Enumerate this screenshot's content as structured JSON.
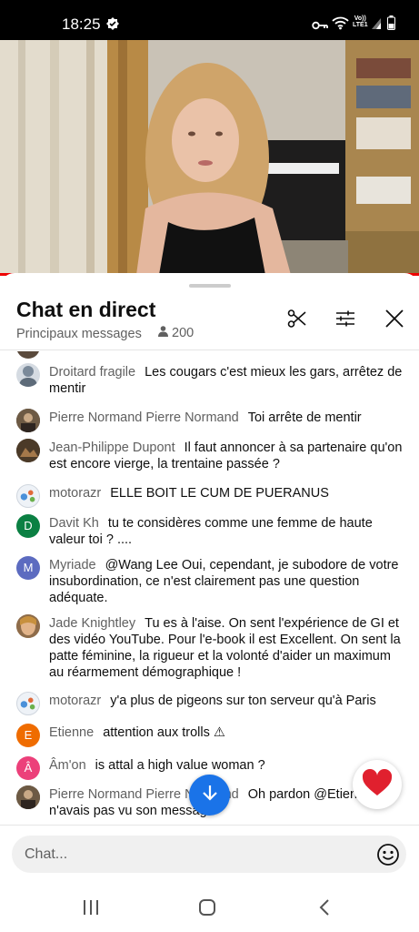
{
  "status_bar": {
    "time": "18:25",
    "network": "Vo)) LTE1"
  },
  "chat": {
    "title": "Chat en direct",
    "filter_label": "Principaux messages",
    "viewer_count": "200",
    "input_placeholder": "Chat...",
    "messages": [
      {
        "author": "Droitard fragile",
        "text": "Les cougars c'est mieux les gars, arrêtez de mentir",
        "avatar": "photo",
        "avatar_color": "#7b8a9a"
      },
      {
        "author": "Pierre Normand Pierre Normand",
        "text": "Toi arrête de mentir",
        "avatar": "photo",
        "avatar_color": "#4a3a2e"
      },
      {
        "author": "Jean-Philippe Dupont",
        "text": "Il faut annoncer à sa partenaire qu'on est encore vierge, la trentaine passée ?",
        "avatar": "photo",
        "avatar_color": "#5c4632"
      },
      {
        "author": "motorazr",
        "text": "ELLE BOIT LE CUM DE PUERANUS",
        "avatar": "photo",
        "avatar_color": "#dfe6ef"
      },
      {
        "author": "Davit Kh",
        "text": "tu te considères comme une femme de haute valeur toi ? ....",
        "avatar": "D",
        "avatar_color": "#0b8043"
      },
      {
        "author": "Myriade",
        "text": "@Wang Lee Oui, cependant, je subodore de votre insubordination, ce n'est clairement pas une question adéquate.",
        "avatar": "M",
        "avatar_color": "#5c6bc0"
      },
      {
        "author": "Jade Knightley",
        "text": "Tu es à l'aise. On sent l'expérience de GI et des vidéo YouTube. Pour l'e-book il est Excellent. On sent la patte féminine, la rigueur et la volonté d'aider un maximum au réarmement démographique !",
        "avatar": "photo",
        "avatar_color": "#c9a27a"
      },
      {
        "author": "motorazr",
        "text": "y'a plus de pigeons sur ton serveur qu'à Paris",
        "avatar": "photo",
        "avatar_color": "#dfe6ef"
      },
      {
        "author": "Etienne",
        "text": "attention aux trolls ⚠",
        "avatar": "E",
        "avatar_color": "#ef6c00"
      },
      {
        "author": "Âm'on",
        "text": "is attal a high value woman ?",
        "avatar": "Â",
        "avatar_color": "#ec407a"
      },
      {
        "author": "Pierre Normand Pierre Normand",
        "text": "Oh pardon @Etienne n'avais pas vu son message",
        "avatar": "photo",
        "avatar_color": "#4a3a2e"
      }
    ]
  },
  "icons": {
    "clip": "scissors-icon",
    "filter": "tune-icon",
    "close": "close-icon",
    "scroll_down": "arrow-down-icon",
    "reaction": "heart-icon",
    "emoji": "emoji-icon"
  },
  "colors": {
    "accent_red": "#ee0000",
    "fab_blue": "#1a73e8",
    "heart_red": "#e0202e"
  }
}
